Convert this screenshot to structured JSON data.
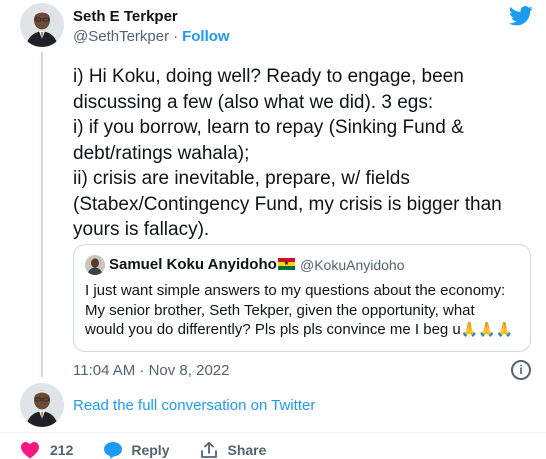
{
  "author": {
    "name": "Seth E Terkper",
    "handle": "@SethTerkper",
    "separator": "·",
    "follow_label": "Follow"
  },
  "tweet": {
    "lines": [
      "i) Hi Koku, doing well? Ready to engage, been",
      "discussing a few (also what we did). 3 egs:",
      "i) if you borrow, learn to repay (Sinking  Fund &",
      "debt/ratings wahala);",
      "ii) crisis are inevitable, prepare, w/ fields",
      "(Stabex/Contingency Fund, my crisis is bigger than",
      "yours is fallacy)."
    ]
  },
  "quote": {
    "name": "Samuel Koku Anyidoho",
    "flag_icon": "ghana-flag-icon",
    "handle": "@KokuAnyidoho",
    "lines": [
      "I just want simple answers to my questions about the economy:",
      "My senior brother, Seth Tekper, given the opportunity, what",
      "would you do differently? Pls pls pls convince me I beg u"
    ],
    "trailing_icons": [
      "folded-hands-icon",
      "folded-hands-icon",
      "folded-hands-icon"
    ]
  },
  "timestamp": "11:04 AM · Nov 8, 2022",
  "info_icon": "info-icon",
  "read_conversation_label": "Read the full conversation on Twitter",
  "actions": {
    "like_count": "212",
    "reply_label": "Reply",
    "share_label": "Share"
  },
  "colors": {
    "twitter_blue": "#1d9bf0",
    "like_red": "#f91880",
    "secondary_text": "#536471",
    "border": "#cfd9de"
  }
}
